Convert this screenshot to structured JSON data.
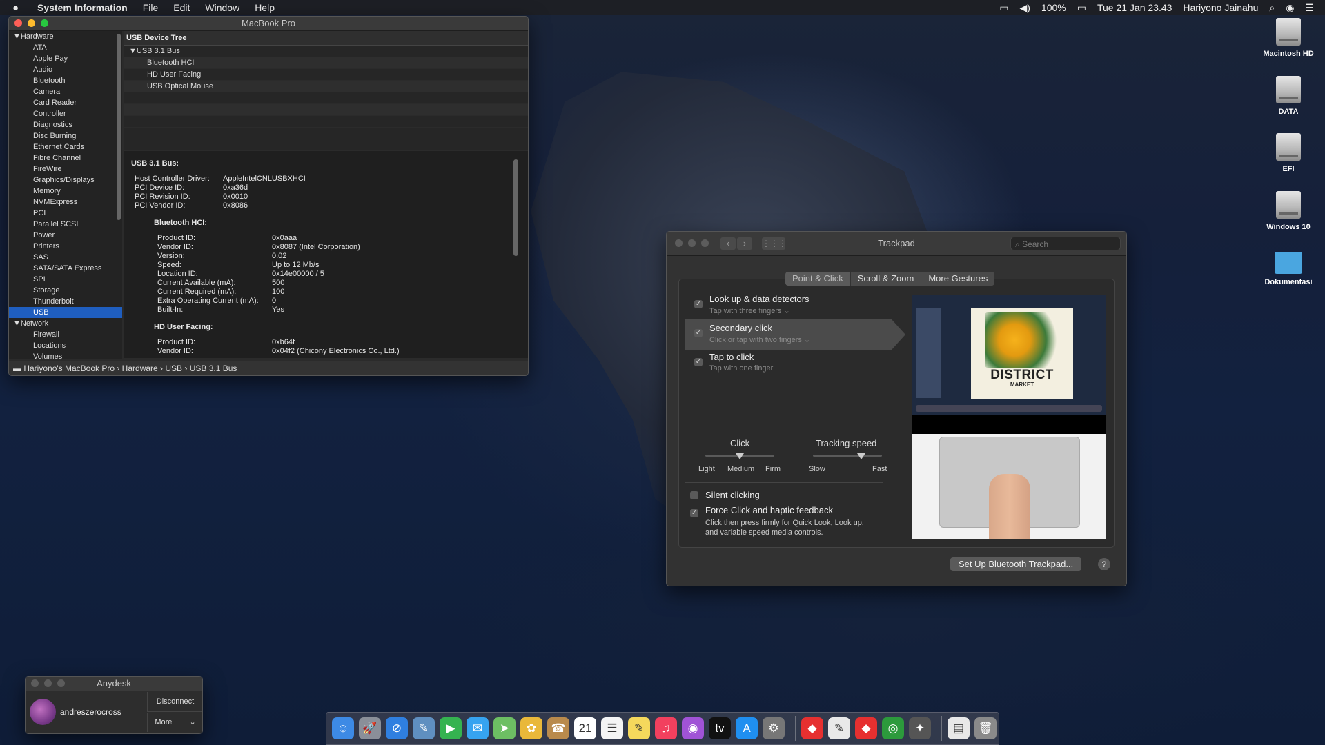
{
  "menubar": {
    "app_name": "System Information",
    "menus": [
      "File",
      "Edit",
      "Window",
      "Help"
    ],
    "battery": "100%",
    "datetime": "Tue 21 Jan  23.43",
    "user": "Hariyono Jainahu"
  },
  "sysinfo": {
    "title": "MacBook Pro",
    "sidebar": [
      {
        "label": "▼Hardware",
        "cat": true
      },
      {
        "label": "ATA"
      },
      {
        "label": "Apple Pay"
      },
      {
        "label": "Audio"
      },
      {
        "label": "Bluetooth"
      },
      {
        "label": "Camera"
      },
      {
        "label": "Card Reader"
      },
      {
        "label": "Controller"
      },
      {
        "label": "Diagnostics"
      },
      {
        "label": "Disc Burning"
      },
      {
        "label": "Ethernet Cards"
      },
      {
        "label": "Fibre Channel"
      },
      {
        "label": "FireWire"
      },
      {
        "label": "Graphics/Displays"
      },
      {
        "label": "Memory"
      },
      {
        "label": "NVMExpress"
      },
      {
        "label": "PCI"
      },
      {
        "label": "Parallel SCSI"
      },
      {
        "label": "Power"
      },
      {
        "label": "Printers"
      },
      {
        "label": "SAS"
      },
      {
        "label": "SATA/SATA Express"
      },
      {
        "label": "SPI"
      },
      {
        "label": "Storage"
      },
      {
        "label": "Thunderbolt"
      },
      {
        "label": "USB",
        "selected": true
      },
      {
        "label": "▼Network",
        "cat": true
      },
      {
        "label": "Firewall"
      },
      {
        "label": "Locations"
      },
      {
        "label": "Volumes"
      }
    ],
    "tree_header": "USB Device Tree",
    "tree": [
      {
        "label": "▼USB 3.1 Bus",
        "child": false
      },
      {
        "label": "Bluetooth HCI",
        "child": true
      },
      {
        "label": "HD User Facing",
        "child": true
      },
      {
        "label": "USB Optical Mouse",
        "child": true
      }
    ],
    "detail": {
      "bus_title": "USB 3.1 Bus:",
      "bus_props": [
        {
          "k": "Host Controller Driver:",
          "v": "AppleIntelCNLUSBXHCI"
        },
        {
          "k": "PCI Device ID:",
          "v": "0xa36d"
        },
        {
          "k": "PCI Revision ID:",
          "v": "0x0010"
        },
        {
          "k": "PCI Vendor ID:",
          "v": "0x8086"
        }
      ],
      "bt_title": "Bluetooth HCI:",
      "bt_props": [
        {
          "k": "Product ID:",
          "v": "0x0aaa"
        },
        {
          "k": "Vendor ID:",
          "v": "0x8087  (Intel Corporation)"
        },
        {
          "k": "Version:",
          "v": "0.02"
        },
        {
          "k": "Speed:",
          "v": "Up to 12 Mb/s"
        },
        {
          "k": "Location ID:",
          "v": "0x14e00000 / 5"
        },
        {
          "k": "Current Available (mA):",
          "v": "500"
        },
        {
          "k": "Current Required (mA):",
          "v": "100"
        },
        {
          "k": "Extra Operating Current (mA):",
          "v": "0"
        },
        {
          "k": "Built-In:",
          "v": "Yes"
        }
      ],
      "hd_title": "HD User Facing:",
      "hd_props": [
        {
          "k": "Product ID:",
          "v": "0xb64f"
        },
        {
          "k": "Vendor ID:",
          "v": "0x04f2  (Chicony Electronics Co., Ltd.)"
        }
      ]
    },
    "path": "Hariyono's MacBook Pro  ›  Hardware  ›  USB  ›  USB 3.1 Bus"
  },
  "trackpad": {
    "title": "Trackpad",
    "search_placeholder": "Search",
    "tabs": [
      "Point & Click",
      "Scroll & Zoom",
      "More Gestures"
    ],
    "options": [
      {
        "title": "Look up & data detectors",
        "sub": "Tap with three fingers ⌄",
        "checked": true
      },
      {
        "title": "Secondary click",
        "sub": "Click or tap with two fingers ⌄",
        "checked": true,
        "selected": true
      },
      {
        "title": "Tap to click",
        "sub": "Tap with one finger",
        "checked": true
      }
    ],
    "click": {
      "label": "Click",
      "ticks": [
        "Light",
        "Medium",
        "Firm"
      ],
      "value": "Medium"
    },
    "tracking": {
      "label": "Tracking speed",
      "ticks": [
        "Slow",
        "Fast"
      ],
      "level": 0.7
    },
    "silent_clicking": {
      "label": "Silent clicking",
      "checked": false
    },
    "force_click": {
      "label": "Force Click and haptic feedback",
      "checked": true,
      "desc1": "Click then press firmly for Quick Look, Look up,",
      "desc2": "and variable speed media controls."
    },
    "preview": {
      "poster_title": "DISTRICT",
      "poster_sub": "MARKET"
    },
    "setup_button": "Set Up Bluetooth Trackpad...",
    "help": "?"
  },
  "anydesk": {
    "title": "Anydesk",
    "user": "andreszerocross",
    "disconnect": "Disconnect",
    "more": "More"
  },
  "desktop": [
    {
      "label": "Macintosh HD",
      "type": "disk"
    },
    {
      "label": "DATA",
      "type": "disk"
    },
    {
      "label": "EFI",
      "type": "disk"
    },
    {
      "label": "Windows 10",
      "type": "disk"
    },
    {
      "label": "Dokumentasi",
      "type": "folder"
    }
  ],
  "dock": {
    "apps": [
      {
        "name": "finder-icon",
        "color": "#3d8ae5",
        "glyph": "☺"
      },
      {
        "name": "launchpad-icon",
        "color": "#8a8f99",
        "glyph": "🚀"
      },
      {
        "name": "safari-icon",
        "color": "#2f7fe0",
        "glyph": "⊘"
      },
      {
        "name": "preview-icon",
        "color": "#5f8fc0",
        "glyph": "✎"
      },
      {
        "name": "facetime-icon",
        "color": "#35b350",
        "glyph": "▶"
      },
      {
        "name": "messages-icon",
        "color": "#36a3f0",
        "glyph": "✉"
      },
      {
        "name": "maps-icon",
        "color": "#6dbf63",
        "glyph": "➤"
      },
      {
        "name": "photos-icon",
        "color": "#e9b83a",
        "glyph": "✿"
      },
      {
        "name": "contacts-icon",
        "color": "#b98a4c",
        "glyph": "☎"
      },
      {
        "name": "calendar-icon",
        "color": "#ffffff",
        "glyph": "21"
      },
      {
        "name": "reminders-icon",
        "color": "#f4f4f4",
        "glyph": "☰"
      },
      {
        "name": "notes-icon",
        "color": "#f5d85c",
        "glyph": "✎"
      },
      {
        "name": "music-icon",
        "color": "#f2405e",
        "glyph": "♫"
      },
      {
        "name": "podcasts-icon",
        "color": "#a053d6",
        "glyph": "◉"
      },
      {
        "name": "tv-icon",
        "color": "#111111",
        "glyph": "tv"
      },
      {
        "name": "app-store-icon",
        "color": "#1f8ff0",
        "glyph": "A"
      },
      {
        "name": "system-preferences-icon",
        "color": "#777777",
        "glyph": "⚙"
      }
    ],
    "extras": [
      {
        "name": "anydesk-icon",
        "color": "#e63030",
        "glyph": "◆"
      },
      {
        "name": "textedit-icon",
        "color": "#e9e9e9",
        "glyph": "✎"
      },
      {
        "name": "anydesk-alt-icon",
        "color": "#e63030",
        "glyph": "◆"
      },
      {
        "name": "network-icon",
        "color": "#2c9a3c",
        "glyph": "◎"
      },
      {
        "name": "utility-icon",
        "color": "#555555",
        "glyph": "✦"
      }
    ],
    "tail": [
      {
        "name": "documents-icon",
        "color": "#e8e8e8",
        "glyph": "▤"
      },
      {
        "name": "trash-icon",
        "color": "#8a8a8a",
        "glyph": "🗑"
      }
    ]
  }
}
